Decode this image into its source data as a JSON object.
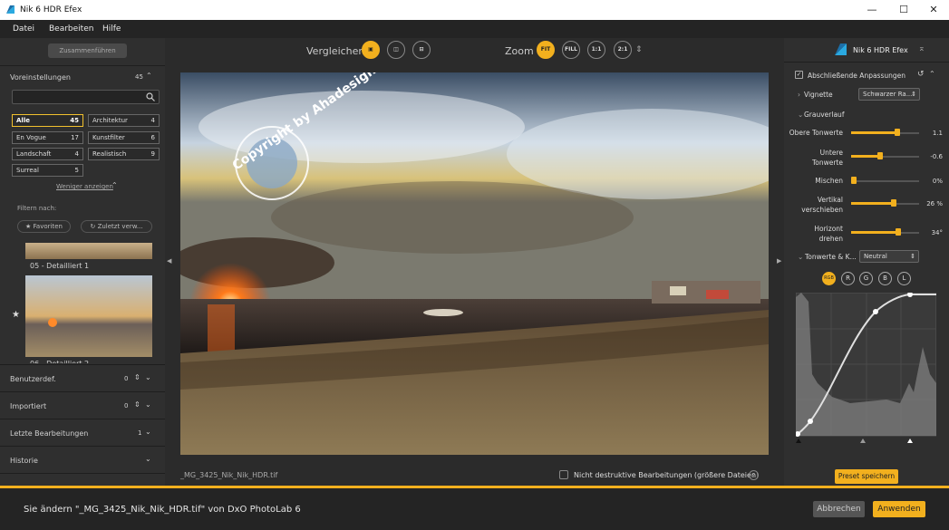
{
  "window": {
    "title": "Nik 6 HDR Efex",
    "minimize": "—",
    "maximize": "☐",
    "close": "✕"
  },
  "menu": [
    "Datei",
    "Bearbeiten",
    "Hilfe"
  ],
  "left": {
    "merge_button": "Zusammenführen",
    "presets_label": "Voreinstellungen",
    "presets_count": "45",
    "categories": [
      {
        "name": "Alle",
        "count": "45"
      },
      {
        "name": "Architektur",
        "count": "4"
      },
      {
        "name": "En Vogue",
        "count": "17"
      },
      {
        "name": "Kunstfilter",
        "count": "6"
      },
      {
        "name": "Landschaft",
        "count": "4"
      },
      {
        "name": "Realistisch",
        "count": "9"
      },
      {
        "name": "Surreal",
        "count": "5"
      }
    ],
    "show_less": "Weniger anzeigen",
    "filter_label": "Filtern nach:",
    "filter_favorites": "Favoriten",
    "filter_recent": "Zuletzt verw...",
    "thumb1_label": "05 - Detailliert 1",
    "thumb2_label": "06 - Detailliert 2",
    "sections": [
      {
        "name": "Benutzerdef.",
        "count": "0"
      },
      {
        "name": "Importiert",
        "count": "0"
      },
      {
        "name": "Letzte Bearbeitungen",
        "count": "1"
      },
      {
        "name": "Historie",
        "count": ""
      }
    ]
  },
  "center": {
    "compare_label": "Vergleichen",
    "zoom_label": "Zoom",
    "zoom_buttons": [
      "FIT",
      "FILL",
      "1:1",
      "2:1"
    ],
    "filename": "_MG_3425_Nik_Nik_HDR.tif",
    "nondestructive": "Nicht destruktive Bearbeitungen (größere Dateien)",
    "watermark": "Copyright by Ahadesign.eu"
  },
  "right": {
    "title": "Nik 6 HDR Efex",
    "final_adjustments": "Abschließende Anpassungen",
    "vignette_label": "Vignette",
    "vignette_value": "Schwarzer Ra...",
    "gradient_label": "Grauverlauf",
    "sliders": [
      {
        "l1": "Obere Tonwerte",
        "l2": "",
        "value": "1.1",
        "pos": 0.68
      },
      {
        "l1": "Untere",
        "l2": "Tonwerte",
        "value": "-0.6",
        "pos": 0.43
      },
      {
        "l1": "Mischen",
        "l2": "",
        "value": "0%",
        "pos": 0.0
      },
      {
        "l1": "Vertikal",
        "l2": "verschieben",
        "value": "26 %",
        "pos": 0.63
      },
      {
        "l1": "Horizont",
        "l2": "drehen",
        "value": "34°",
        "pos": 0.69
      }
    ],
    "tone_label": "Tonwerte & K...",
    "tone_value": "Neutral",
    "channels": [
      "RGB",
      "R",
      "G",
      "B",
      "L"
    ],
    "save_preset": "Preset speichern"
  },
  "bottom": {
    "message": "Sie ändern \"_MG_3425_Nik_Nik_HDR.tif\" von DxO PhotoLab 6",
    "cancel": "Abbrechen",
    "apply": "Anwenden"
  },
  "colors": {
    "accent": "#f2b01e"
  }
}
